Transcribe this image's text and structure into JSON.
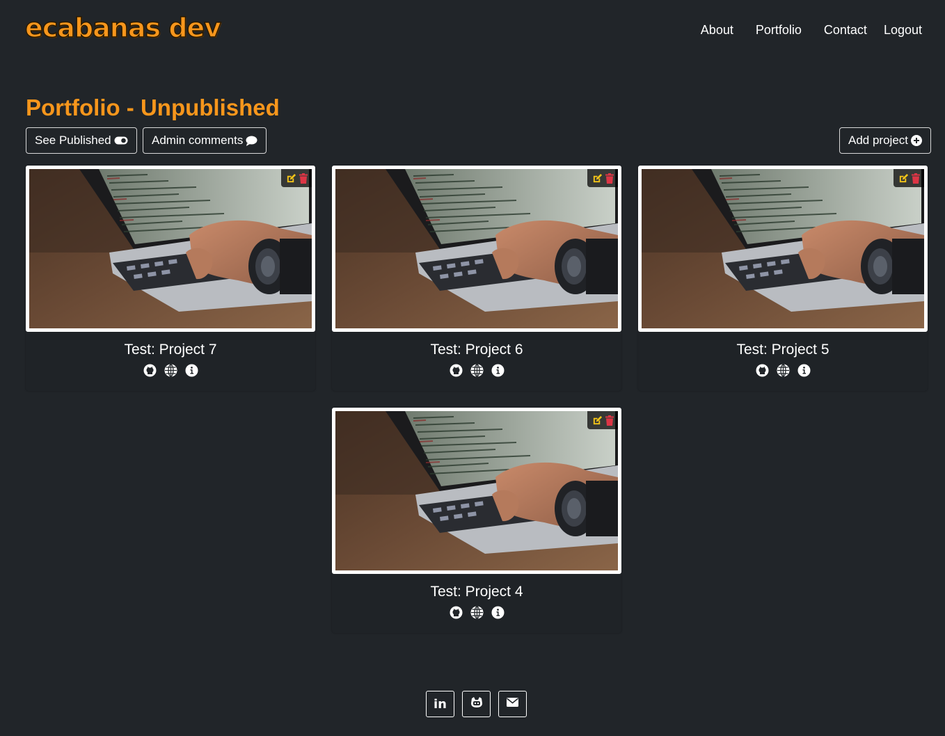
{
  "header": {
    "logo_text": "ecabanas dev",
    "nav": [
      "About",
      "Portfolio",
      "Contact",
      "Logout"
    ]
  },
  "main": {
    "title": "Portfolio - Unpublished",
    "see_published_label": "See Published",
    "admin_comments_label": "Admin comments",
    "add_project_label": "Add project"
  },
  "projects": [
    {
      "title": "Test: Project 7"
    },
    {
      "title": "Test: Project 6"
    },
    {
      "title": "Test: Project 5"
    },
    {
      "title": "Test: Project 4"
    }
  ],
  "footer": {
    "icons": [
      "linkedin-icon",
      "gitlab-icon",
      "envelope-icon"
    ],
    "linkedin_text": "in"
  },
  "colors": {
    "background": "#212529",
    "accent": "#f7961c",
    "edit": "#f5c518",
    "delete": "#dc3545"
  }
}
